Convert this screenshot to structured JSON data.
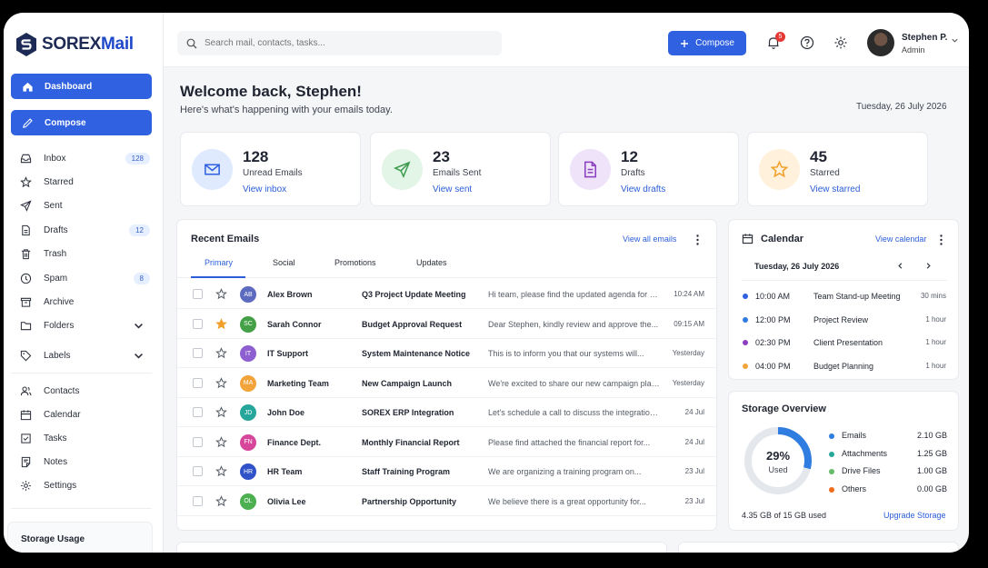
{
  "brand": {
    "name_prefix": "SOREX",
    "name_suffix": "Mail"
  },
  "sidebar": {
    "dashboard_label": "Dashboard",
    "compose_label": "Compose",
    "items": [
      {
        "label": "Inbox",
        "count": "128",
        "icon": "inbox-icon"
      },
      {
        "label": "Starred",
        "icon": "star-icon"
      },
      {
        "label": "Sent",
        "icon": "send-icon"
      },
      {
        "label": "Drafts",
        "count": "12",
        "icon": "draft-icon"
      },
      {
        "label": "Trash",
        "icon": "trash-icon"
      },
      {
        "label": "Spam",
        "count": "8",
        "icon": "spam-icon"
      },
      {
        "label": "Archive",
        "icon": "archive-icon"
      },
      {
        "label": "Folders",
        "icon": "folder-icon"
      },
      {
        "label": "Labels",
        "icon": "label-icon"
      },
      {
        "label": "Contacts",
        "icon": "contacts-icon"
      },
      {
        "label": "Calendar",
        "icon": "calendar-icon"
      },
      {
        "label": "Tasks",
        "icon": "tasks-icon"
      },
      {
        "label": "Notes",
        "icon": "notes-icon"
      },
      {
        "label": "Settings",
        "icon": "gear-icon"
      }
    ],
    "storage_usage_label": "Storage Usage"
  },
  "header": {
    "search_placeholder": "Search mail, contacts, tasks...",
    "compose_label": "Compose",
    "notification_count": "5",
    "user_name": "Stephen P.",
    "user_role": "Admin"
  },
  "welcome": {
    "title": "Welcome back, Stephen!",
    "subtitle": "Here's what's happening with your emails today.",
    "date": "Tuesday, 26 July 2026"
  },
  "stats": [
    {
      "value": "128",
      "label": "Unread Emails",
      "link": "View inbox",
      "color": "#dfeaff",
      "icon": "mail-icon"
    },
    {
      "value": "23",
      "label": "Emails Sent",
      "link": "View sent",
      "color": "#e2f5e6",
      "icon": "send-icon"
    },
    {
      "value": "12",
      "label": "Drafts",
      "link": "View drafts",
      "color": "#efe3fa",
      "icon": "draft-icon"
    },
    {
      "value": "45",
      "label": "Starred",
      "link": "View starred",
      "color": "#fff1dc",
      "icon": "star-icon"
    }
  ],
  "recent_emails": {
    "title": "Recent Emails",
    "view_all": "View all emails",
    "tabs": [
      "Primary",
      "Social",
      "Promotions",
      "Updates"
    ],
    "rows": [
      {
        "initials": "AB",
        "color": "#5c6bc0",
        "sender": "Alex Brown",
        "subject": "Q3 Project Update Meeting",
        "preview": "Hi team, please find the updated agenda for our...",
        "time": "10:24 AM",
        "starred": false
      },
      {
        "initials": "SC",
        "color": "#43a047",
        "sender": "Sarah Connor",
        "subject": "Budget Approval Request",
        "preview": "Dear Stephen, kindly review and approve the...",
        "time": "09:15 AM",
        "starred": true
      },
      {
        "initials": "IT",
        "color": "#8e5fd0",
        "sender": "IT Support",
        "subject": "System Maintenance Notice",
        "preview": "This is to inform you that our systems will...",
        "time": "Yesterday",
        "starred": false
      },
      {
        "initials": "MA",
        "color": "#f2a33a",
        "sender": "Marketing Team",
        "subject": "New Campaign Launch",
        "preview": "We're excited to share our new campaign plan...",
        "time": "Yesterday",
        "starred": false
      },
      {
        "initials": "JD",
        "color": "#26a69a",
        "sender": "John Doe",
        "subject": "SOREX ERP Integration",
        "preview": "Let's schedule a call to discuss the integration...",
        "time": "24 Jul",
        "starred": false
      },
      {
        "initials": "FN",
        "color": "#d6479b",
        "sender": "Finance Dept.",
        "subject": "Monthly Financial Report",
        "preview": "Please find attached the financial report for...",
        "time": "24 Jul",
        "starred": false
      },
      {
        "initials": "HR",
        "color": "#2f52c8",
        "sender": "HR Team",
        "subject": "Staff Training Program",
        "preview": "We are organizing a training program on...",
        "time": "23 Jul",
        "starred": false
      },
      {
        "initials": "OL",
        "color": "#4caf50",
        "sender": "Olivia Lee",
        "subject": "Partnership Opportunity",
        "preview": "We believe there is a great opportunity for...",
        "time": "23 Jul",
        "starred": false
      }
    ]
  },
  "calendar": {
    "title": "Calendar",
    "view_link": "View calendar",
    "date": "Tuesday, 26 July 2026",
    "events": [
      {
        "time": "10:00 AM",
        "title": "Team Stand-up Meeting",
        "duration": "30 mins",
        "color": "#2f61e0"
      },
      {
        "time": "12:00 PM",
        "title": "Project Review",
        "duration": "1 hour",
        "color": "#2f7de0"
      },
      {
        "time": "02:30 PM",
        "title": "Client Presentation",
        "duration": "1 hour",
        "color": "#8e3fbf"
      },
      {
        "time": "04:00 PM",
        "title": "Budget Planning",
        "duration": "1 hour",
        "color": "#f2a33a"
      }
    ]
  },
  "storage": {
    "title": "Storage Overview",
    "percent": "29%",
    "percent_value": 29,
    "used_label": "Used",
    "items": [
      {
        "name": "Emails",
        "value": "2.10 GB",
        "color": "#2f7de0"
      },
      {
        "name": "Attachments",
        "value": "1.25 GB",
        "color": "#26a69a"
      },
      {
        "name": "Drive Files",
        "value": "1.00 GB",
        "color": "#66bb6a"
      },
      {
        "name": "Others",
        "value": "0.00 GB",
        "color": "#f26b1d"
      }
    ],
    "used_text": "4.35 GB of 15 GB used",
    "upgrade_label": "Upgrade Storage"
  }
}
